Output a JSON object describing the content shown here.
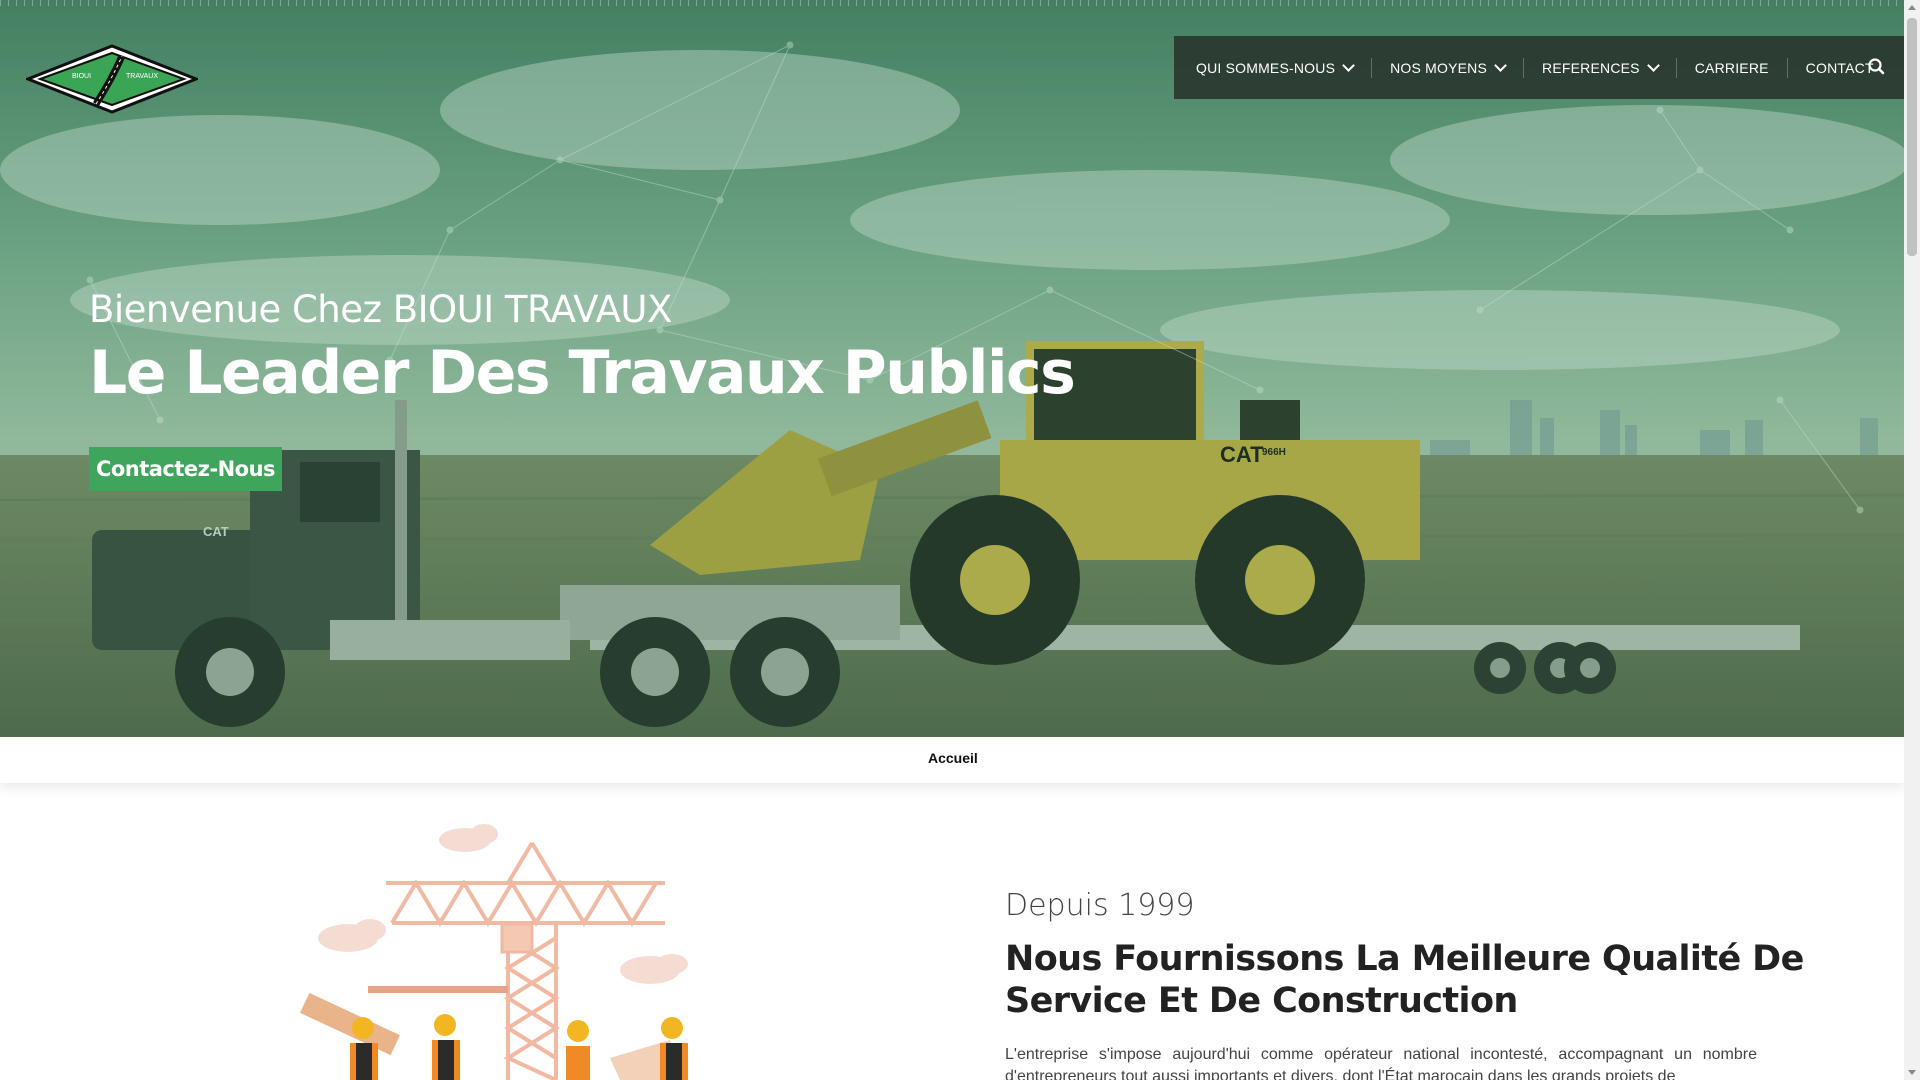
{
  "header": {
    "logo_text_left": "BIOUI",
    "logo_text_right": "TRAVAUX",
    "nav": [
      {
        "label": "QUI SOMMES-NOUS",
        "dropdown": true
      },
      {
        "label": "NOS MOYENS",
        "dropdown": true
      },
      {
        "label": "REFERENCES",
        "dropdown": true
      },
      {
        "label": "CARRIERE",
        "dropdown": false
      },
      {
        "label": "CONTACT",
        "dropdown": false
      }
    ],
    "search_icon": "search-icon"
  },
  "hero": {
    "subtitle": "Bienvenue Chez BIOUI TRAVAUX",
    "title": "Le Leader Des Travaux Publics",
    "cta_label": "Contactez-Nous",
    "truck_badge": "CAT",
    "loader_badge": "CAT",
    "loader_model": "966H"
  },
  "breadcrumb": {
    "label": "Accueil"
  },
  "about": {
    "since": "Depuis 1999",
    "title": "Nous Fournissons La Meilleure Qualité De Service Et De Construction",
    "text": "L'entreprise s'impose aujourd'hui comme opérateur national incontesté, accompagnant un nombre d'entrepreneurs tout aussi importants et divers, dont l'État marocain dans les grands projets de"
  },
  "colors": {
    "accent": "#3fa45c",
    "nav_bg": "#262d28",
    "logo_green": "#3aa655"
  }
}
